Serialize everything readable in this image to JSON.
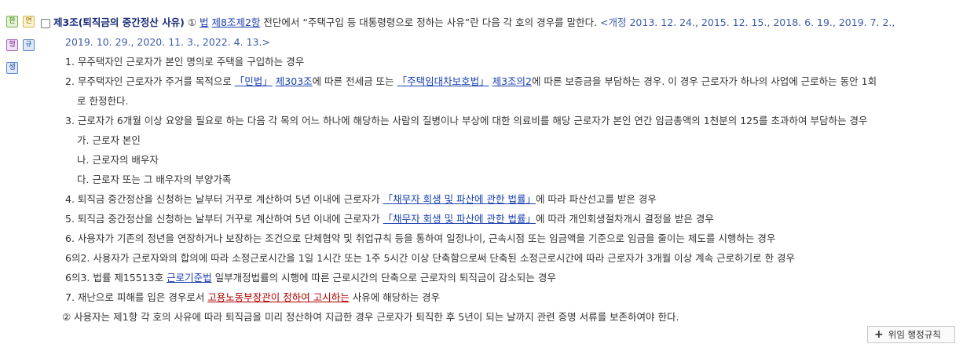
{
  "badges": [
    {
      "icon": "pan-icon",
      "label": "판",
      "color": "#79b04d"
    },
    {
      "icon": "yeon-icon",
      "label": "연",
      "color": "#d8b63f"
    },
    {
      "icon": "haeng-icon",
      "label": "행",
      "color": "#a169bb"
    },
    {
      "icon": "gyu-icon",
      "label": "규",
      "color": "#5b86c8"
    },
    {
      "icon": "saeng-icon",
      "label": "생",
      "color": "#5b86c8"
    }
  ],
  "article": {
    "title": "제3조(퇴직금의 중간정산 사유)",
    "para_num": "①",
    "law_link": "법",
    "article_link": "제8조제2항",
    "intro": " 전단에서 “주택구입 등 대통령령으로 정하는 사유”란 다음 각 호의 경우를 말한다. ",
    "history_1": "<개정 2013. 12. 24., 2015. 12. 15., 2018. 6. 19., 2019. 7. 2.,",
    "history_2": "2019. 10. 29., 2020. 11. 3., 2022. 4. 13.>"
  },
  "items": {
    "i1": "1. 무주택자인 근로자가 본인 명의로 주택을 구입하는 경우",
    "i2_a": "2. 무주택자인 근로자가 주거를 목적으로 ",
    "i2_law1": "「민법」",
    "i2_art1": "제303조",
    "i2_b": "에 따른 전세금 또는 ",
    "i2_law2": "「주택임대차보호법」",
    "i2_art2": "제3조의2",
    "i2_c": "에 따른 보증금을 부담하는 경우. 이 경우 근로자가 하나의 사업에 근로하는 동안 1회",
    "i2_d": "로 한정한다.",
    "i3": "3. 근로자가 6개월 이상 요양을 필요로 하는 다음 각 목의 어느 하나에 해당하는 사람의 질병이나 부상에 대한 의료비를 해당 근로자가 본인 연간 임금총액의 1천분의 125를 초과하여 부담하는 경우",
    "i3_ga": "가. 근로자 본인",
    "i3_na": "나. 근로자의 배우자",
    "i3_da": "다. 근로자 또는 그 배우자의 부양가족",
    "i4_a": "4. 퇴직금 중간정산을 신청하는 날부터 거꾸로 계산하여 5년 이내에 근로자가 ",
    "i4_law": "「채무자 회생 및 파산에 관한 법률」",
    "i4_b": "에 따라 파산선고를 받은 경우",
    "i5_a": "5. 퇴직금 중간정산을 신청하는 날부터 거꾸로 계산하여 5년 이내에 근로자가 ",
    "i5_law": "「채무자 회생 및 파산에 관한 법률」",
    "i5_b": "에 따라 개인회생절차개시 결정을 받은 경우",
    "i6": "6. 사용자가 기존의 정년을 연장하거나 보장하는 조건으로 단체협약 및 취업규칙 등을 통하여 일정나이, 근속시점 또는 임금액을 기준으로 임금을 줄이는 제도를 시행하는 경우",
    "i6_2": "6의2. 사용자가 근로자와의 합의에 따라 소정근로시간을 1일 1시간 또는 1주 5시간 이상 단축함으로써 단축된 소정근로시간에 따라 근로자가 3개월 이상 계속 근로하기로 한 경우",
    "i6_3_a": "6의3. 법률 제15513호 ",
    "i6_3_link": "근로기준법",
    "i6_3_b": " 일부개정법률의 시행에 따른 근로시간의 단축으로 근로자의 퇴직금이 감소되는 경우",
    "i7_a": "7. 재난으로 피해를 입은 경우로서 ",
    "i7_link": "고용노동부장관이 정하여 고시하는",
    "i7_b": " 사유에 해당하는 경우"
  },
  "para2": "② 사용자는 제1항 각 호의 사유에 따라 퇴직금을 미리 정산하여 지급한 경우 근로자가 퇴직한 후 5년이 되는 날까지 관련 증명 서류를 보존하여야 한다.",
  "button": {
    "plus": "+",
    "label": "위임 행정규칙"
  }
}
